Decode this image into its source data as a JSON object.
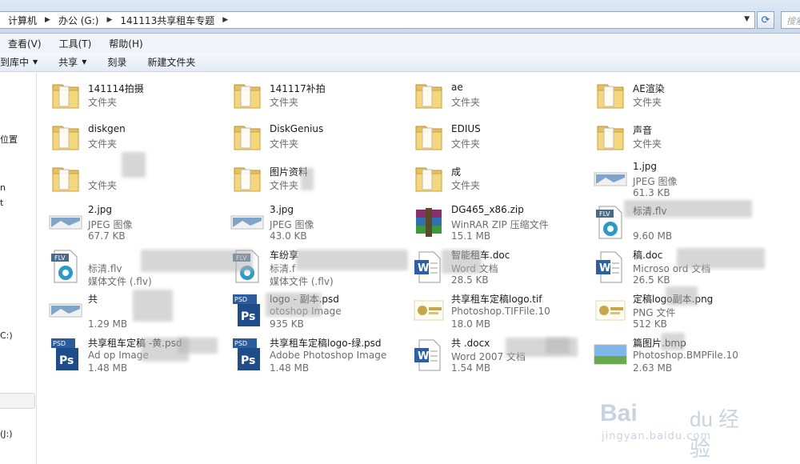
{
  "address": {
    "crumbs": [
      "计算机",
      "办公 (G:)",
      "141113共享租车专题"
    ],
    "search_placeholder": "搜索"
  },
  "menu": [
    "查看(V)",
    "工具(T)",
    "帮助(H)"
  ],
  "commands": [
    "到库中",
    "共享",
    "刻录",
    "新建文件夹"
  ],
  "nav": {
    "items": [
      "位置",
      "n",
      "t",
      "C:)",
      "(J:)"
    ]
  },
  "files": [
    {
      "name": "141114拍摄",
      "type": "文件夹",
      "size": "",
      "icon": "folder-icon"
    },
    {
      "name": "141117补拍",
      "type": "文件夹",
      "size": "",
      "icon": "folder-icon"
    },
    {
      "name": "ae",
      "type": "文件夹",
      "size": "",
      "icon": "folder-icon"
    },
    {
      "name": "AE渲染",
      "type": "文件夹",
      "size": "",
      "icon": "folder-icon"
    },
    {
      "name": "diskgen",
      "type": "文件夹",
      "size": "",
      "icon": "folder-icon"
    },
    {
      "name": "DiskGenius",
      "type": "文件夹",
      "size": "",
      "icon": "folder-icon"
    },
    {
      "name": "EDIUS",
      "type": "文件夹",
      "size": "",
      "icon": "folder-icon"
    },
    {
      "name": "声音",
      "type": "文件夹",
      "size": "",
      "icon": "folder-icon"
    },
    {
      "name": "",
      "type": "文件夹",
      "size": "",
      "icon": "folder-icon"
    },
    {
      "name": "图片资料",
      "type": "文件夹",
      "size": "",
      "icon": "folder-icon"
    },
    {
      "name": "成",
      "type": "文件夹",
      "size": "",
      "icon": "folder-icon"
    },
    {
      "name": "1.jpg",
      "type": "JPEG 图像",
      "size": "61.3 KB",
      "icon": "jpg-icon"
    },
    {
      "name": "2.jpg",
      "type": "JPEG 图像",
      "size": "67.7 KB",
      "icon": "jpg-icon"
    },
    {
      "name": "3.jpg",
      "type": "JPEG 图像",
      "size": "43.0 KB",
      "icon": "jpg-icon"
    },
    {
      "name": "DG465_x86.zip",
      "type": "WinRAR ZIP 压缩文件",
      "size": "15.1 MB",
      "icon": "winrar-icon"
    },
    {
      "name": "标清.flv",
      "type": "",
      "size": "9.60 MB",
      "icon": "flv-icon"
    },
    {
      "name": "",
      "type": "标清.flv",
      "size": "媒体文件 (.flv)",
      "icon": "flv-icon"
    },
    {
      "name": "车纷享",
      "type": "标清.f",
      "size": "媒体文件 (.flv)",
      "icon": "flv-icon"
    },
    {
      "name": "智能租车.doc",
      "type": "Word 文档",
      "size": "28.5 KB",
      "icon": "doc-icon"
    },
    {
      "name": "稿.doc",
      "type": "Microso      ord 文档",
      "size": "26.5 KB",
      "icon": "doc-icon"
    },
    {
      "name": "共",
      "type": "",
      "size": "1.29 MB",
      "icon": "jpg-icon"
    },
    {
      "name": "logo - 副本.psd",
      "type": "otoshop Image",
      "size": "935 KB",
      "icon": "psd-icon"
    },
    {
      "name": "共享租车定稿logo.tif",
      "type": "Photoshop.TIFFile.10",
      "size": "18.0 MB",
      "icon": "tif-icon"
    },
    {
      "name": "定稿logo副本.png",
      "type": "PNG 文件",
      "size": "512 KB",
      "icon": "png-icon"
    },
    {
      "name": "共享租车定稿   -黄.psd",
      "type": "Ad               op Image",
      "size": "1.48 MB",
      "icon": "psd-icon"
    },
    {
      "name": "共享租车定稿logo-绿.psd",
      "type": "Adobe Photoshop Image",
      "size": "1.48 MB",
      "icon": "psd-icon"
    },
    {
      "name": "共                 .docx",
      "type": "Word 2007 文档",
      "size": "1.54 MB",
      "icon": "docx-icon"
    },
    {
      "name": "篇图片.bmp",
      "type": "Photoshop.BMPFile.10",
      "size": "2.63 MB",
      "icon": "bmp-icon"
    }
  ],
  "watermark": {
    "brand": "Bai",
    "brand2": "du 经验",
    "url": "jingyan.baidu.com"
  }
}
